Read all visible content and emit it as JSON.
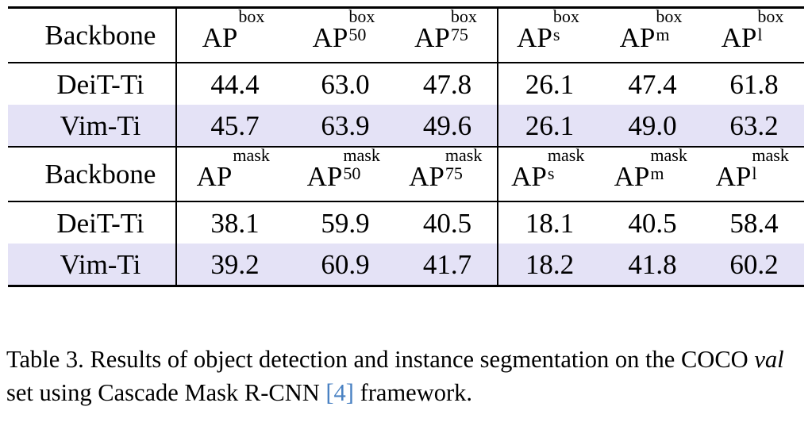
{
  "table": {
    "id": "Table 3",
    "columns_group_1": {
      "backbone_header": "Backbone",
      "metrics": [
        {
          "base": "AP",
          "sup": "box",
          "sub": ""
        },
        {
          "base": "AP",
          "sup": "box",
          "sub": "50"
        },
        {
          "base": "AP",
          "sup": "box",
          "sub": "75"
        },
        {
          "base": "AP",
          "sup": "box",
          "sub": "s"
        },
        {
          "base": "AP",
          "sup": "box",
          "sub": "m"
        },
        {
          "base": "AP",
          "sup": "box",
          "sub": "l"
        }
      ]
    },
    "columns_group_2": {
      "backbone_header": "Backbone",
      "metrics": [
        {
          "base": "AP",
          "sup": "mask",
          "sub": ""
        },
        {
          "base": "AP",
          "sup": "mask",
          "sub": "50"
        },
        {
          "base": "AP",
          "sup": "mask",
          "sub": "75"
        },
        {
          "base": "AP",
          "sup": "mask",
          "sub": "s"
        },
        {
          "base": "AP",
          "sup": "mask",
          "sub": "m"
        },
        {
          "base": "AP",
          "sup": "mask",
          "sub": "l"
        }
      ]
    },
    "rows_group_1": [
      {
        "backbone": "DeiT-Ti",
        "highlighted": false,
        "values": [
          "44.4",
          "63.0",
          "47.8",
          "26.1",
          "47.4",
          "61.8"
        ]
      },
      {
        "backbone": "Vim-Ti",
        "highlighted": true,
        "values": [
          "45.7",
          "63.9",
          "49.6",
          "26.1",
          "49.0",
          "63.2"
        ]
      }
    ],
    "rows_group_2": [
      {
        "backbone": "DeiT-Ti",
        "highlighted": false,
        "values": [
          "38.1",
          "59.9",
          "40.5",
          "18.1",
          "40.5",
          "58.4"
        ]
      },
      {
        "backbone": "Vim-Ti",
        "highlighted": true,
        "values": [
          "39.2",
          "60.9",
          "41.7",
          "18.2",
          "41.8",
          "60.2"
        ]
      }
    ],
    "highlight_color": "#e4e2f6",
    "rule_color": "#000000"
  },
  "caption": {
    "label": "Table 3.",
    "text_part_1": "Results of object detection and instance segmentation on the COCO ",
    "italic_term": "val",
    "text_part_2": " set using Cascade Mask R-CNN ",
    "citation": "[4]",
    "citation_color": "#4a82c3",
    "text_part_3": " framework."
  }
}
